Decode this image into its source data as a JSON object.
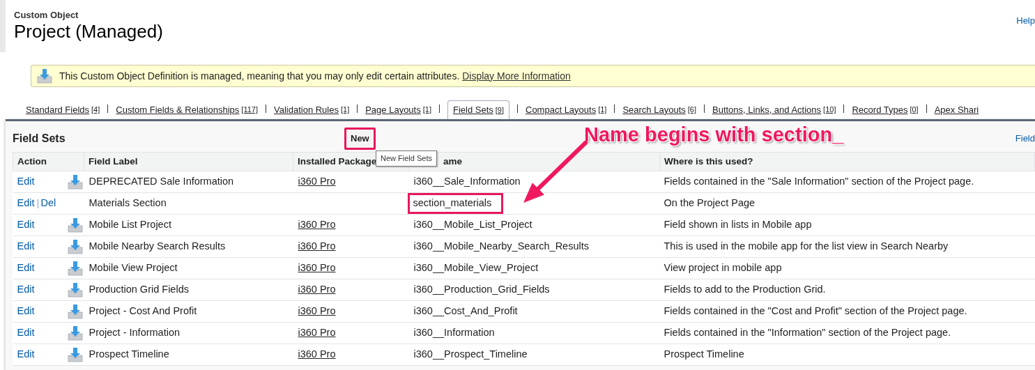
{
  "header": {
    "kicker": "Custom Object",
    "title": "Project (Managed)",
    "help_link": "Help"
  },
  "notice": {
    "text": "This Custom Object Definition is managed, meaning that you may only edit certain attributes.",
    "link": "Display More Information"
  },
  "tabs": [
    {
      "label": "Standard Fields",
      "count": "[4]",
      "selected": false
    },
    {
      "label": "Custom Fields & Relationships",
      "count": "[117]",
      "selected": false
    },
    {
      "label": "Validation Rules",
      "count": "[1]",
      "selected": false
    },
    {
      "label": "Page Layouts",
      "count": "[1]",
      "selected": false
    },
    {
      "label": "Field Sets",
      "count": "[9]",
      "selected": true
    },
    {
      "label": "Compact Layouts",
      "count": "[1]",
      "selected": false
    },
    {
      "label": "Search Layouts",
      "count": "[6]",
      "selected": false
    },
    {
      "label": "Buttons, Links, and Actions",
      "count": "[10]",
      "selected": false
    },
    {
      "label": "Record Types",
      "count": "[0]",
      "selected": false
    },
    {
      "label": "Apex Shari"
    }
  ],
  "panel": {
    "title": "Field Sets",
    "new_button": "New",
    "tooltip": "New Field Sets",
    "side_link": "Field"
  },
  "table": {
    "columns": [
      "Action",
      "Field Label",
      "Installed Package",
      "ame",
      "Where is this used?"
    ],
    "rows": [
      {
        "actions": [
          "Edit"
        ],
        "managed": true,
        "label": "DEPRECATED Sale Information",
        "package": "i360 Pro",
        "name": "i360__Sale_Information",
        "where": "Fields contained in the \"Sale Information\" section of the Project page.",
        "annotated": false
      },
      {
        "actions": [
          "Edit",
          "Del"
        ],
        "managed": false,
        "label": "Materials Section",
        "name": "section_materials",
        "where": "On the Project Page",
        "annotated": true
      },
      {
        "actions": [
          "Edit"
        ],
        "managed": true,
        "label": "Mobile List Project",
        "package": "i360 Pro",
        "name": "i360__Mobile_List_Project",
        "where": "Field shown in lists in Mobile app",
        "annotated": false
      },
      {
        "actions": [
          "Edit"
        ],
        "managed": true,
        "label": "Mobile Nearby Search Results",
        "package": "i360 Pro",
        "name": "i360__Mobile_Nearby_Search_Results",
        "where": "This is used in the mobile app for the list view in Search Nearby",
        "annotated": false
      },
      {
        "actions": [
          "Edit"
        ],
        "managed": true,
        "label": "Mobile View Project",
        "package": "i360 Pro",
        "name": "i360__Mobile_View_Project",
        "where": "View project in mobile app",
        "annotated": false
      },
      {
        "actions": [
          "Edit"
        ],
        "managed": true,
        "label": "Production Grid Fields",
        "package": "i360 Pro",
        "name": "i360__Production_Grid_Fields",
        "where": "Fields to add to the Production Grid.",
        "annotated": false
      },
      {
        "actions": [
          "Edit"
        ],
        "managed": true,
        "label": "Project - Cost And Profit",
        "package": "i360 Pro",
        "name": "i360__Cost_And_Profit",
        "where": "Fields contained in the \"Cost and Profit\" section of the Project page.",
        "annotated": false
      },
      {
        "actions": [
          "Edit"
        ],
        "managed": true,
        "label": "Project - Information",
        "package": "i360 Pro",
        "name": "i360__Information",
        "where": "Fields contained in the \"Information\" section of the Project page.",
        "annotated": false
      },
      {
        "actions": [
          "Edit"
        ],
        "managed": true,
        "label": "Prospect Timeline",
        "package": "i360 Pro",
        "name": "i360__Prospect_Timeline",
        "where": "Prospect Timeline",
        "annotated": false
      }
    ]
  },
  "annotation": {
    "text": "Name begins with section_"
  }
}
